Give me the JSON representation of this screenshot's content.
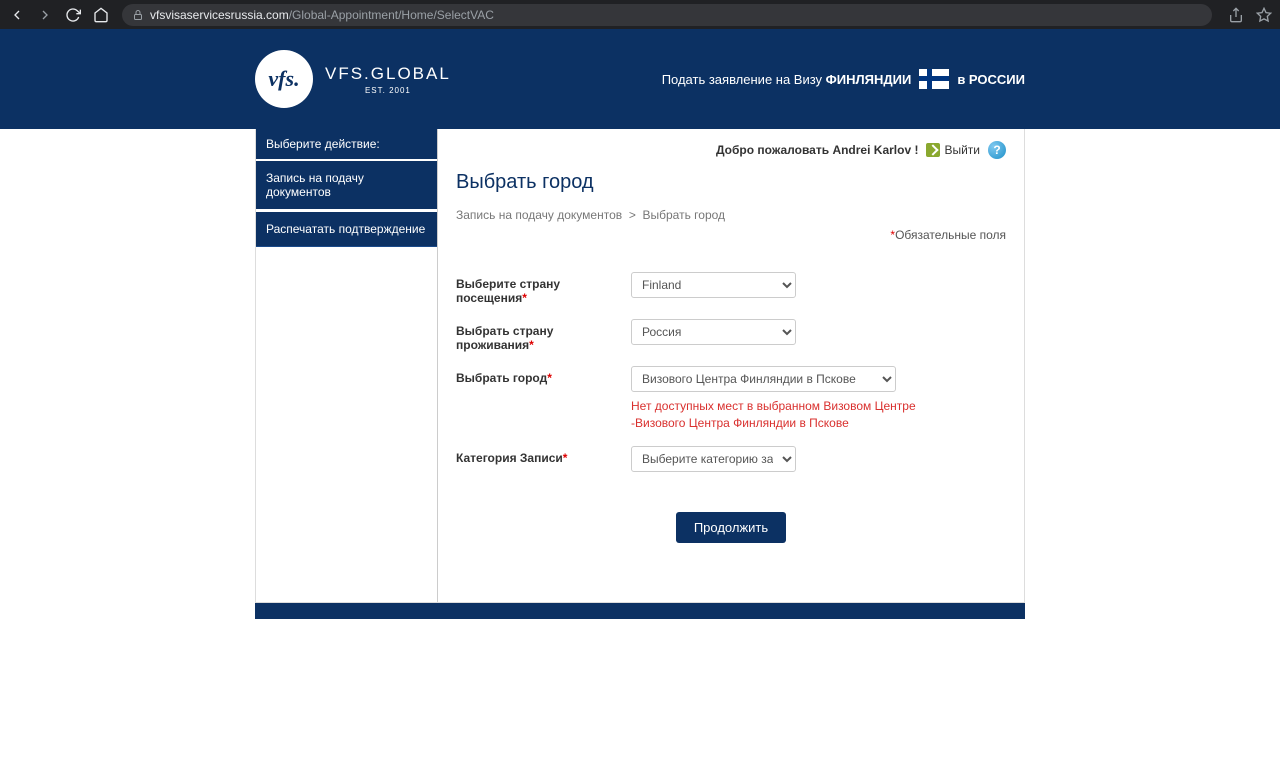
{
  "browser": {
    "url_domain": "vfsvisaservicesrussia.com",
    "url_path": "/Global-Appointment/Home/SelectVAC"
  },
  "header": {
    "logo_main": "VFS.GLOBAL",
    "logo_sub": "EST. 2001",
    "right_pre": "Подать заявление на Визу ",
    "right_country": "ФИНЛЯНДИИ",
    "right_post": "в РОССИИ"
  },
  "sidebar": {
    "title": "Выберите действие:",
    "items": [
      {
        "label": "Запись на подачу документов"
      },
      {
        "label": "Распечатать подтверждение"
      }
    ]
  },
  "topbar": {
    "welcome": "Добро пожаловать Andrei Karlov !",
    "logout": "Выйти"
  },
  "page": {
    "title": "Выбрать город",
    "breadcrumb_1": "Запись на подачу документов",
    "breadcrumb_sep": ">",
    "breadcrumb_2": "Выбрать город",
    "required_note": "Обязательные поля"
  },
  "form": {
    "country_visit_label": "Выберите страну посещения",
    "country_visit_value": "Finland",
    "country_reside_label": "Выбрать страну проживания",
    "country_reside_value": "Россия",
    "city_label": "Выбрать город",
    "city_value": "Визового Центра Финляндии в Пскове",
    "city_error": "Нет доступных мест в выбранном Визовом Центре -Визового Центра Финляндии в Пскове",
    "category_label": "Категория Записи",
    "category_placeholder": "Выберите категорию записи",
    "submit": "Продолжить"
  }
}
